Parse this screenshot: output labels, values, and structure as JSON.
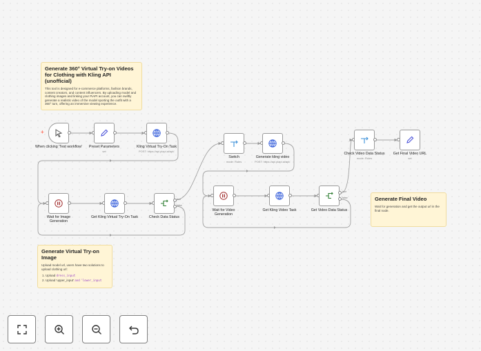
{
  "notes": {
    "intro": {
      "title": "Generate 360° Virtual Try-on Videos for Clothing with Kling API (unofficial)",
      "body": "This tool is designed for e-commerce platforms, fashion brands, content creators, and content influencers. By uploading model and clothing images and linking your PiAPI account, you can swiftly generate a realistic video of the model sporting the outfit with a 360° turn, offering an immersive viewing experience."
    },
    "tryon": {
      "title": "Generate Virtual Try-on Image",
      "body": "Upload model url, users have two solutions to upload clothing url:",
      "step1_prefix": "Upload ",
      "step1_code": "dress_input",
      "step2_prefix": "Upload 'upper_input' ",
      "step2_and": "and",
      "step2_code": "'lower_input"
    },
    "final": {
      "title": "Generate Final Video",
      "body": "Wait for generation and get the output url in the final node."
    }
  },
  "nodes": {
    "trigger": {
      "label": "When clicking 'Test workflow'",
      "icon": "cursor-icon"
    },
    "preset": {
      "label": "Preset Parameters",
      "sub": "set",
      "icon": "pencil-icon"
    },
    "kling_tryon": {
      "label": "Kling Virtual Try-On Task",
      "sub": "POST: https://api.piapi.ai/api/...",
      "icon": "globe-icon"
    },
    "wait_image": {
      "label": "Wait for Image Generation",
      "icon": "pause-icon"
    },
    "get_tryon": {
      "label": "Get Kling Virtual Try-On Task",
      "icon": "globe-icon"
    },
    "check_data": {
      "label": "Check Data Status",
      "icon": "if-icon",
      "true_label": "true",
      "false_label": "false"
    },
    "switch": {
      "label": "Switch",
      "sub": "mode: Rules",
      "icon": "switch-icon"
    },
    "gen_video": {
      "label": "Generate kling video",
      "sub": "POST: https://api.piapi.ai/api/...",
      "icon": "globe-icon"
    },
    "wait_video": {
      "label": "Wait for Video Generation",
      "icon": "pause-icon"
    },
    "get_video": {
      "label": "Get Kling Video Task",
      "icon": "globe-icon"
    },
    "video_status": {
      "label": "Get Video Data Status",
      "icon": "if-icon",
      "true_label": "true",
      "false_label": "false"
    },
    "check_video": {
      "label": "Check Video Data Status",
      "sub": "mode: Rules",
      "icon": "switch-icon"
    },
    "final_url": {
      "label": "Get Final Video URL",
      "sub": "set",
      "icon": "pencil-icon"
    }
  },
  "controls": {
    "fit": "fit-view-icon",
    "zoom_in": "zoom-in-icon",
    "zoom_out": "zoom-out-icon",
    "undo": "undo-icon"
  },
  "colors": {
    "trigger_plus": "#ff6d5a",
    "wait_icon": "#a02c2c",
    "http_icon": "#2a55d8",
    "set_icon": "#4a52d8",
    "if_icon": "#2e7d32",
    "switch_icon": "#3a8fd8",
    "sticky_bg": "#fff5d6"
  }
}
